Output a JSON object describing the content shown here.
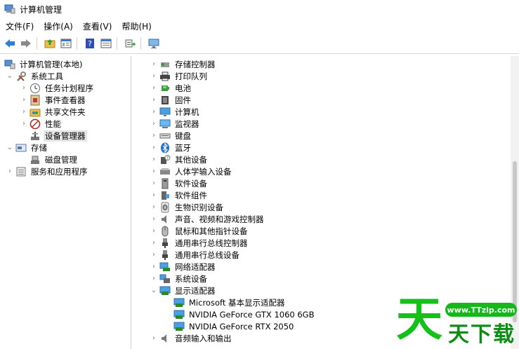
{
  "window": {
    "title": "计算机管理"
  },
  "menu": [
    "文件(F)",
    "操作(A)",
    "查看(V)",
    "帮助(H)"
  ],
  "toolbar_icons": [
    "back-arrow-icon",
    "forward-arrow-icon",
    "up-folder-icon",
    "show-hide-tree-icon",
    "help-icon",
    "properties-icon",
    "export-list-icon",
    "monitor-icon"
  ],
  "left_tree": {
    "root": "计算机管理(本地)",
    "system_tools": "系统工具",
    "task_scheduler": "任务计划程序",
    "event_viewer": "事件查看器",
    "shared_folders": "共享文件夹",
    "performance": "性能",
    "device_manager": "设备管理器",
    "storage": "存储",
    "disk_management": "磁盘管理",
    "services_apps": "服务和应用程序"
  },
  "devices": [
    "存储控制器",
    "打印队列",
    "电池",
    "固件",
    "计算机",
    "监视器",
    "键盘",
    "蓝牙",
    "其他设备",
    "人体学输入设备",
    "软件设备",
    "软件组件",
    "生物识别设备",
    "声音、视频和游戏控制器",
    "鼠标和其他指针设备",
    "通用串行总线控制器",
    "通用串行总线设备",
    "网络适配器",
    "系统设备",
    "显示适配器"
  ],
  "display_adapters": [
    "Microsoft 基本显示适配器",
    "NVIDIA GeForce GTX 1060 6GB",
    "NVIDIA GeForce RTX 2050"
  ],
  "last_device": "音频输入和输出",
  "watermark": {
    "url": "www.TTzip.com",
    "big": "天",
    "text": "天下载"
  }
}
